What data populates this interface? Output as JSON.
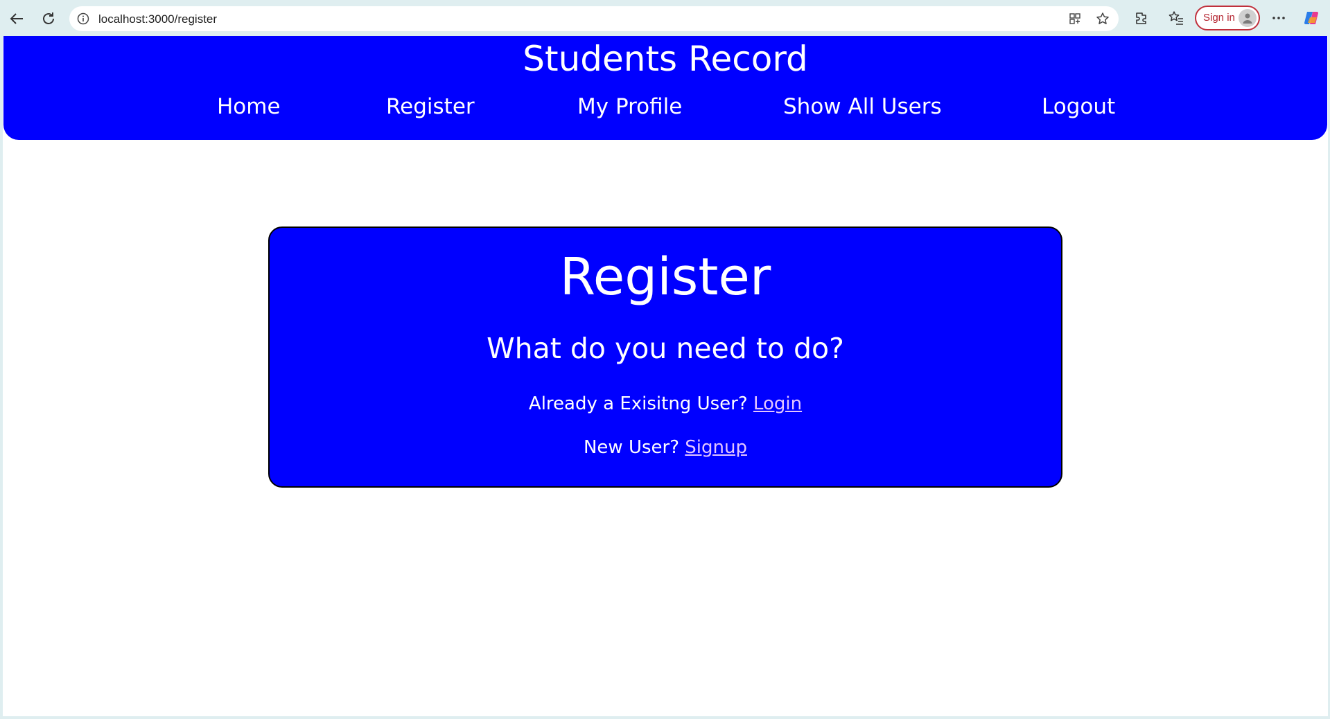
{
  "browser": {
    "url": "localhost:3000/register",
    "sign_in_label": "Sign in",
    "icons": [
      "back-icon",
      "refresh-icon",
      "info-icon",
      "app-grid-icon",
      "star-icon",
      "extensions-icon",
      "favorites-icon",
      "avatar-icon",
      "more-icon",
      "copilot-icon"
    ]
  },
  "site": {
    "title": "Students Record",
    "nav": {
      "home": "Home",
      "register": "Register",
      "profile": "My Profile",
      "show_all": "Show All Users",
      "logout": "Logout"
    }
  },
  "card": {
    "title": "Register",
    "subtitle": "What do you need to do?",
    "existing_text": "Already a Exisitng User?",
    "login_link": "Login",
    "new_text": "New User?",
    "signup_link": "Signup"
  },
  "colors": {
    "brand_blue": "#0000ff",
    "link_color": "#e3c5ff",
    "page_bg": "#ffffff",
    "chrome_bg": "#dfeef0",
    "signin_accent": "#c0303c"
  }
}
